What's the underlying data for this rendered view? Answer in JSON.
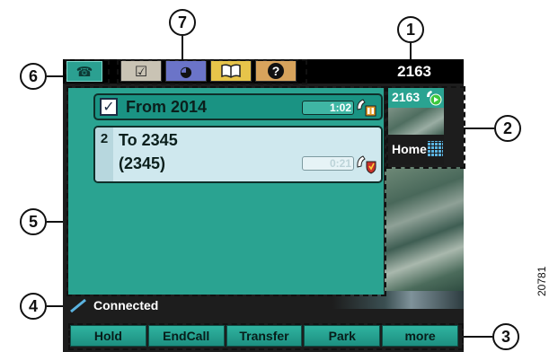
{
  "callouts": [
    "1",
    "2",
    "3",
    "4",
    "5",
    "6",
    "7"
  ],
  "topbar": {
    "line_icon": "phone-icon",
    "tabs": [
      {
        "icon": "checklist-icon",
        "glyph": "☑"
      },
      {
        "icon": "globe-icon",
        "glyph": "◕"
      },
      {
        "icon": "book-icon",
        "glyph": "📖"
      },
      {
        "icon": "help-icon",
        "glyph": "?"
      }
    ],
    "directory_number": "2163"
  },
  "calls": [
    {
      "label": "From 2014",
      "timer": "1:02",
      "state_icon": "hold-handset-icon"
    },
    {
      "index": "2",
      "line1": "To 2345",
      "line2": "(2345)",
      "timer": "0:21",
      "state_icon": "secure-handset-icon"
    }
  ],
  "side_line": {
    "number": "2163",
    "label": "Home"
  },
  "status": {
    "text": "Connected",
    "icon": "connected-line-icon"
  },
  "softkeys": [
    "Hold",
    "EndCall",
    "Transfer",
    "Park",
    "more"
  ],
  "figure_number": "20781",
  "colors": {
    "teal": "#2aa391",
    "call_selected_bg": "#cfe8ee",
    "screen_bg": "#1d1d1d"
  }
}
